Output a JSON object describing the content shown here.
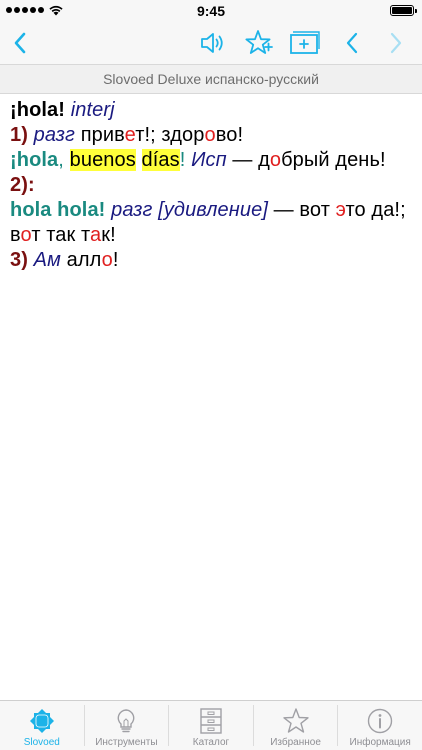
{
  "status_bar": {
    "time": "9:45"
  },
  "toolbar": {
    "back_icon": "chevron-left-icon",
    "sound_icon": "speaker-icon",
    "favorite_icon": "star-plus-icon",
    "add_card_icon": "add-card-icon",
    "prev_icon": "chevron-left-icon",
    "next_icon": "chevron-right-icon"
  },
  "title": "Slovoed Deluxe испанско-русский",
  "entry": {
    "headword": "¡hola!",
    "pos": "interj",
    "sense1_num": "1)",
    "sense1_label": "разг",
    "sense1_text_a": "прив",
    "sense1_stress1": "е",
    "sense1_text_b": "т!; здор",
    "sense1_stress2": "о",
    "sense1_text_c": "во!",
    "phrase_a": "¡hola",
    "phrase_comma": ",",
    "phrase_b": "buenos",
    "phrase_c": "días",
    "phrase_excl": "!",
    "phrase_label": "Исп",
    "phrase_dash": "— д",
    "phrase_stress": "о",
    "phrase_rest": "брый день!",
    "sense2_num": "2):",
    "sense2_phrase": "hola hola!",
    "sense2_label": "разг",
    "sense2_note": "[удивление]",
    "sense2_text_a": "— вот ",
    "sense2_stress1": "э",
    "sense2_text_b": "то да!; в",
    "sense2_stress2": "о",
    "sense2_text_c": "т так т",
    "sense2_stress3": "а",
    "sense2_text_d": "к!",
    "sense3_num": "3)",
    "sense3_label": "Ам",
    "sense3_text_a": "алл",
    "sense3_stress": "о",
    "sense3_text_b": "!"
  },
  "tabs": [
    {
      "label": "Slovoed",
      "icon": "slovoed-logo-icon",
      "active": true
    },
    {
      "label": "Инструменты",
      "icon": "lightbulb-icon",
      "active": false
    },
    {
      "label": "Каталог",
      "icon": "cabinet-icon",
      "active": false
    },
    {
      "label": "Избранное",
      "icon": "star-icon",
      "active": false
    },
    {
      "label": "Информация",
      "icon": "info-icon",
      "active": false
    }
  ],
  "colors": {
    "accent": "#1cb3e8",
    "headword_es": "#1a8a80",
    "grammar": "#1a1a80",
    "sense_number": "#7a1010",
    "stress": "#e02020",
    "highlight": "#ffff3a"
  }
}
